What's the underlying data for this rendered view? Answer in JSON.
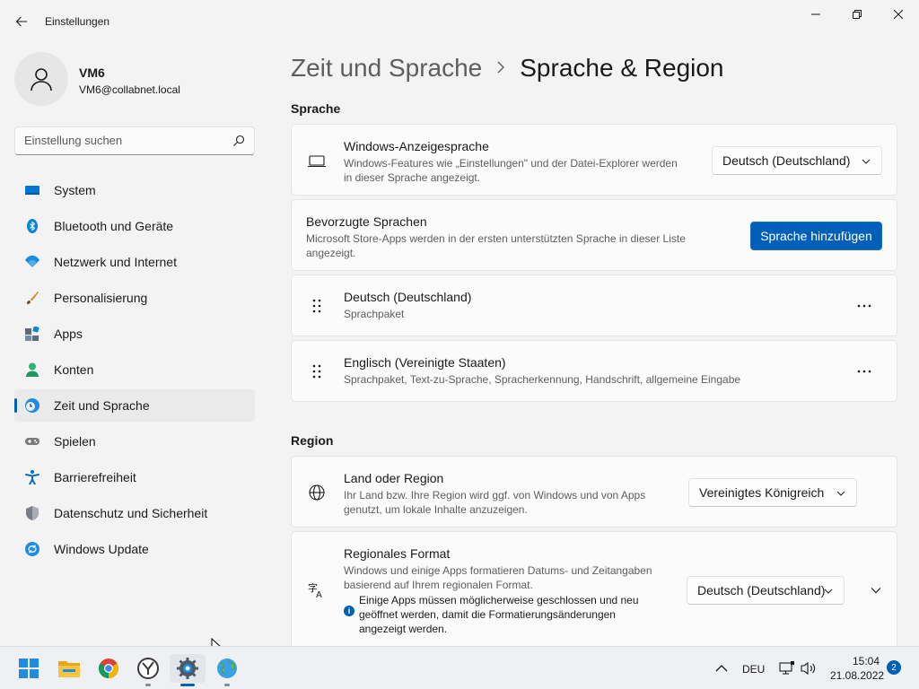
{
  "window": {
    "title": "Einstellungen"
  },
  "profile": {
    "name": "VM6",
    "email": "VM6@collabnet.local"
  },
  "search": {
    "placeholder": "Einstellung suchen"
  },
  "sidebar": {
    "items": [
      {
        "label": "System",
        "icon": "monitor-icon",
        "color": "#0078d4"
      },
      {
        "label": "Bluetooth und Geräte",
        "icon": "bluetooth-icon",
        "color": "#0a84d6"
      },
      {
        "label": "Netzwerk und Internet",
        "icon": "wifi-icon",
        "color": "#1e8de0"
      },
      {
        "label": "Personalisierung",
        "icon": "brush-icon",
        "color": "#d9822b"
      },
      {
        "label": "Apps",
        "icon": "apps-icon",
        "color": "#5b6b7c"
      },
      {
        "label": "Konten",
        "icon": "person-icon",
        "color": "#2bb673"
      },
      {
        "label": "Zeit und Sprache",
        "icon": "clock-globe-icon",
        "color": "#1e8de0",
        "active": true
      },
      {
        "label": "Spielen",
        "icon": "gamepad-icon",
        "color": "#7a7a7a"
      },
      {
        "label": "Barrierefreiheit",
        "icon": "accessibility-icon",
        "color": "#0a6cc4"
      },
      {
        "label": "Datenschutz und Sicherheit",
        "icon": "shield-icon",
        "color": "#7a7f87"
      },
      {
        "label": "Windows Update",
        "icon": "update-icon",
        "color": "#1e8de0"
      }
    ]
  },
  "breadcrumb": {
    "parent": "Zeit und Sprache",
    "current": "Sprache & Region"
  },
  "sections": {
    "language": "Sprache",
    "region": "Region"
  },
  "display_language": {
    "title": "Windows-Anzeigesprache",
    "desc_line1": "Windows-Features wie „Einstellungen\" und der Datei-Explorer werden",
    "desc_line2": "in dieser Sprache angezeigt.",
    "value": "Deutsch (Deutschland)"
  },
  "preferred_languages": {
    "title": "Bevorzugte Sprachen",
    "desc_line1": "Microsoft Store-Apps werden in der ersten unterstützten Sprache in dieser Liste",
    "desc_line2": "angezeigt.",
    "button": "Sprache hinzufügen"
  },
  "languages": [
    {
      "name": "Deutsch (Deutschland)",
      "detail": "Sprachpaket"
    },
    {
      "name": "Englisch (Vereinigte Staaten)",
      "detail": "Sprachpaket, Text-zu-Sprache, Spracherkennung, Handschrift, allgemeine Eingabe"
    }
  ],
  "country": {
    "title": "Land oder Region",
    "desc_line1": "Ihr Land bzw. Ihre Region wird ggf. von Windows und von Apps",
    "desc_line2": "genutzt, um lokale Inhalte anzuzeigen.",
    "value": "Vereinigtes Königreich"
  },
  "regional_format": {
    "title": "Regionales Format",
    "desc_line1": "Windows und einige Apps formatieren Datums- und Zeitangaben",
    "desc_line2": "basierend auf Ihrem regionalen Format.",
    "info_line1": "Einige Apps müssen möglicherweise geschlossen und neu",
    "info_line2": "geöffnet werden, damit die Formatierungsänderungen",
    "info_line3": "angezeigt werden.",
    "value": "Deutsch (Deutschland)"
  },
  "taskbar": {
    "apps": [
      "start-icon",
      "file-explorer-icon",
      "chrome-icon",
      "clock-app-icon",
      "settings-icon",
      "globe-app-icon"
    ],
    "language": "DEU",
    "time": "15:04",
    "date": "21.08.2022",
    "notifications": "2"
  },
  "colors": {
    "accent": "#005fb8",
    "background": "#f3f3f3",
    "card": "#fbfbfb"
  }
}
